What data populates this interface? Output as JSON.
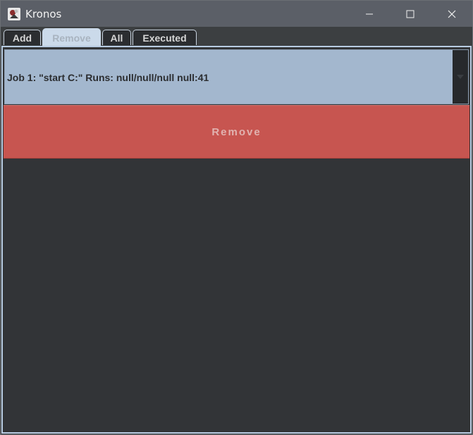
{
  "window": {
    "title": "Kronos",
    "icon": "kronos-app-icon",
    "controls": [
      "minimize-icon",
      "maximize-icon",
      "close-icon"
    ]
  },
  "tabs": [
    {
      "label": "Add",
      "active": false
    },
    {
      "label": "Remove",
      "active": true
    },
    {
      "label": "All",
      "active": false
    },
    {
      "label": "Executed",
      "active": false
    }
  ],
  "remove_panel": {
    "job_select": {
      "selected_value": "Job 1: \"start C:\" Runs: null/null/null null:41",
      "icon": "chevron-down-icon"
    },
    "remove_button_label": "Remove"
  },
  "colors": {
    "titlebar": "#5b5f67",
    "background": "#323437",
    "active_tab": "#cbdaea",
    "select_background": "#a3b7ce",
    "remove_button": "#c75550",
    "remove_button_text": "#e1b3b0"
  }
}
